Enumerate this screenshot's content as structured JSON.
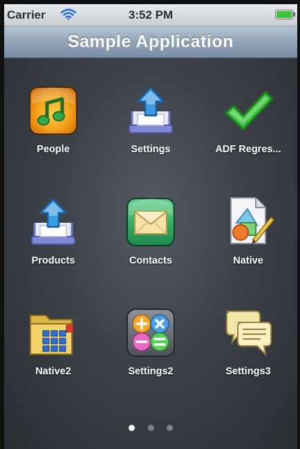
{
  "status_bar": {
    "carrier": "Carrier",
    "time": "3:52 PM",
    "battery_color": "#3cc23c"
  },
  "nav_bar": {
    "title": "Sample Application"
  },
  "apps": [
    {
      "label": "People",
      "icon": "music-note-icon"
    },
    {
      "label": "Settings",
      "icon": "upload-tray-icon"
    },
    {
      "label": "ADF Regres...",
      "icon": "checkmark-icon"
    },
    {
      "label": "Products",
      "icon": "upload-tray-icon"
    },
    {
      "label": "Contacts",
      "icon": "envelope-icon"
    },
    {
      "label": "Native",
      "icon": "drawing-icon"
    },
    {
      "label": "Native2",
      "icon": "folder-grid-icon"
    },
    {
      "label": "Settings2",
      "icon": "calculator-icon"
    },
    {
      "label": "Settings3",
      "icon": "chat-bubbles-icon"
    }
  ],
  "page_indicator": {
    "pages": 3,
    "current": 1
  }
}
